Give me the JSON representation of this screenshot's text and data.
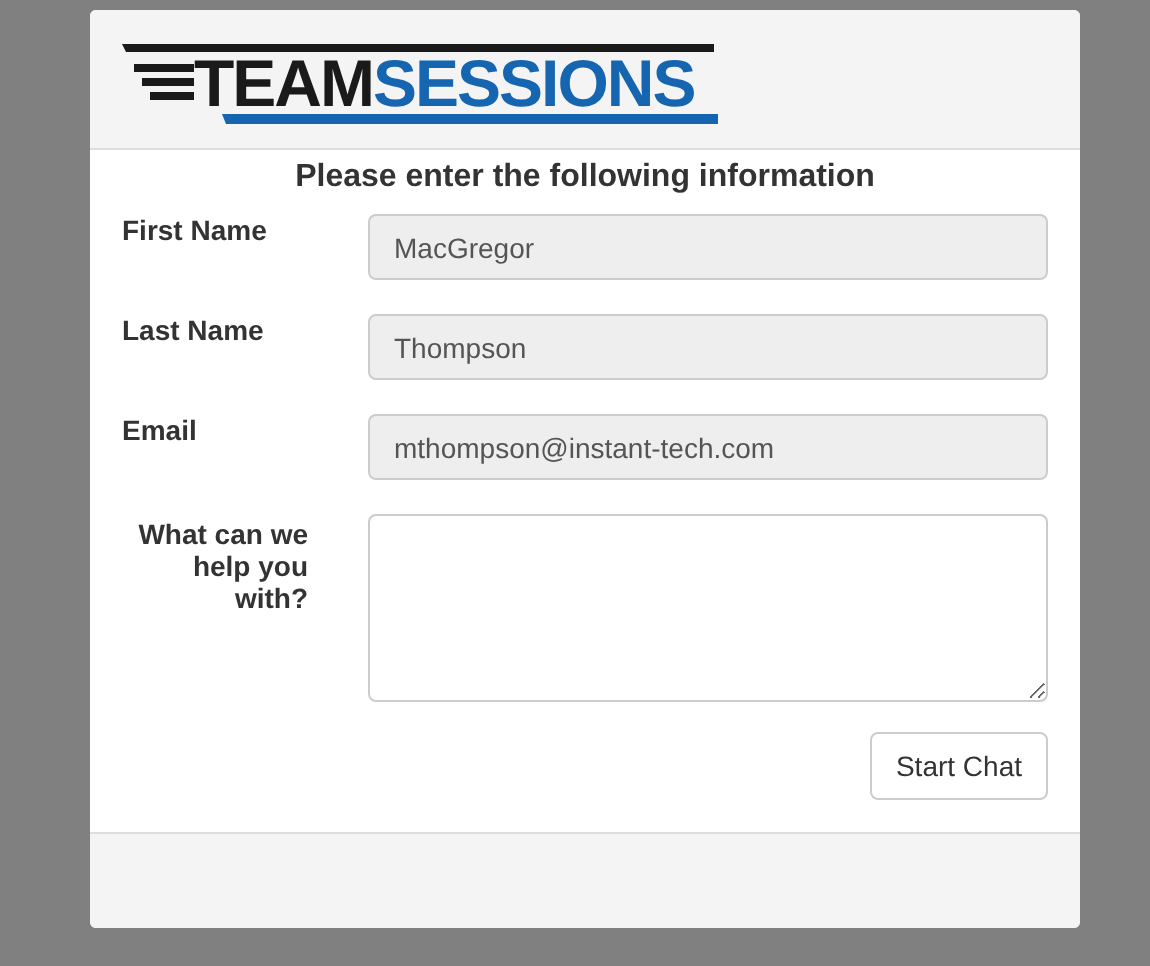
{
  "logo": {
    "words": [
      "TEAM",
      "SESSIONS"
    ]
  },
  "heading": "Please enter the following information",
  "fields": [
    {
      "kind": "text",
      "label": "First Name",
      "value": "MacGregor",
      "disabled": true
    },
    {
      "kind": "text",
      "label": "Last Name",
      "value": "Thompson",
      "disabled": true
    },
    {
      "kind": "text",
      "label": "Email",
      "value": "mthompson@instant-tech.com",
      "disabled": true
    },
    {
      "kind": "textarea",
      "label": "What can we help you with?",
      "disabled": false
    }
  ],
  "button": "Start Chat"
}
